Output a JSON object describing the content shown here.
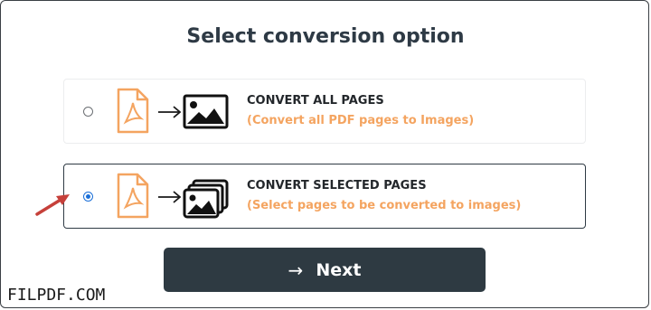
{
  "title": "Select conversion option",
  "options": [
    {
      "heading": "CONVERT ALL PAGES",
      "description": "(Convert all PDF pages to Images)",
      "selected": false,
      "doc_icon": "pdf-document-icon",
      "target_icon": "image-icon"
    },
    {
      "heading": "CONVERT SELECTED PAGES",
      "description": "(Select pages to be converted to images)",
      "selected": true,
      "doc_icon": "pdf-document-icon",
      "target_icon": "multiple-images-icon"
    }
  ],
  "next_button": {
    "arrow": "→",
    "label": "Next"
  },
  "watermark": "FILPDF.COM",
  "colors": {
    "accent_orange": "#f4a460",
    "button_dark": "#2e3a42",
    "pointer_red": "#c6403a",
    "radio_blue": "#1b6fd8"
  }
}
